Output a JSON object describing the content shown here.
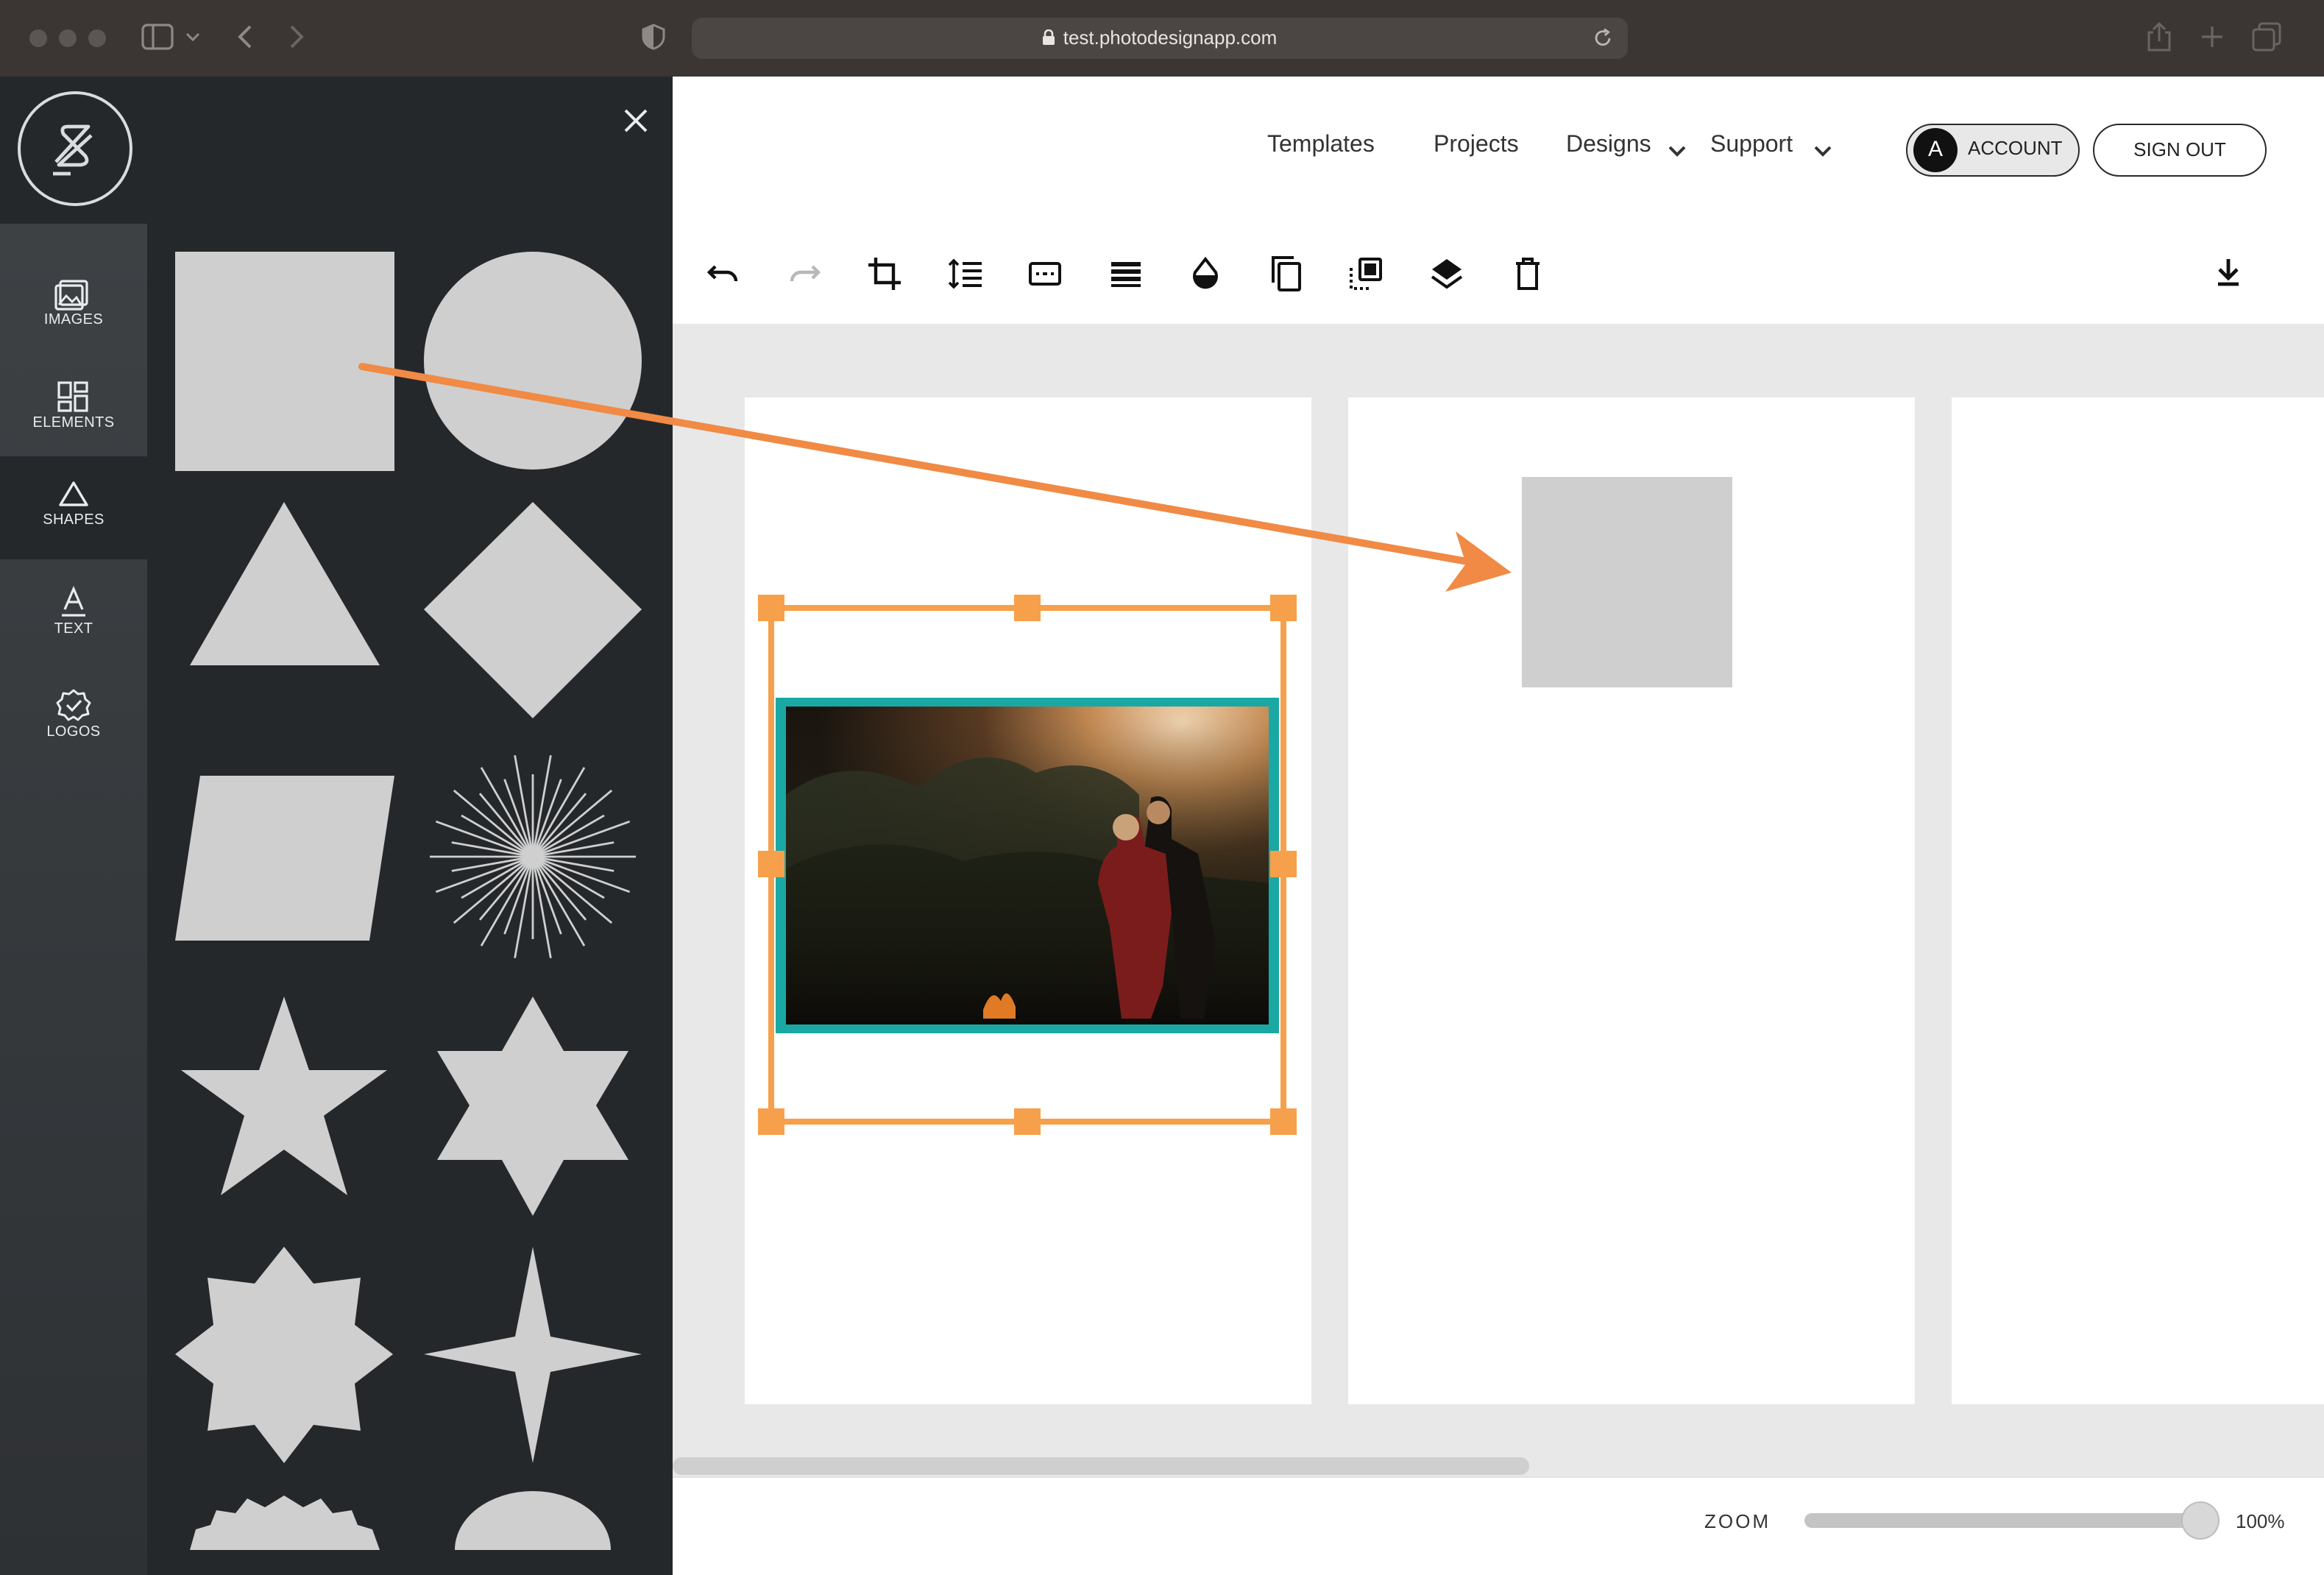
{
  "browser": {
    "url": "test.photodesignapp.com"
  },
  "sidebar": {
    "items": [
      {
        "label": "IMAGES",
        "icon": "images-icon"
      },
      {
        "label": "ELEMENTS",
        "icon": "elements-icon"
      },
      {
        "label": "SHAPES",
        "icon": "triangle-icon",
        "active": true
      },
      {
        "label": "TEXT",
        "icon": "text-icon"
      },
      {
        "label": "LOGOS",
        "icon": "logos-badge-icon"
      }
    ]
  },
  "shapes_panel": {
    "shapes": [
      "square",
      "circle",
      "triangle",
      "diamond",
      "parallelogram",
      "starburst",
      "star-5",
      "star-6",
      "star-8",
      "star-4",
      "sun-burst",
      "semicircle"
    ],
    "shape_color": "#cfcfcf"
  },
  "header": {
    "nav": {
      "templates": "Templates",
      "projects": "Projects",
      "designs": "Designs",
      "support": "Support"
    },
    "account": {
      "avatar_letter": "A",
      "label": "ACCOUNT"
    },
    "signout": "SIGN OUT"
  },
  "toolbar": {
    "tools": [
      "undo-icon",
      "redo-icon",
      "crop-icon",
      "line-spacing-icon",
      "caption-icon",
      "stripes-icon",
      "opacity-drop-icon",
      "duplicate-icon",
      "arrange-icon",
      "layers-icon",
      "delete-icon",
      "download-icon"
    ]
  },
  "footer": {
    "zoom_label": "ZOOM",
    "zoom_value": "100%",
    "zoom_level": 1.0
  },
  "colors": {
    "selection": "#f7a04b",
    "arrow": "#f08a45",
    "photo_border": "#1aa8a4",
    "sidebar_dark": "#25282b"
  }
}
